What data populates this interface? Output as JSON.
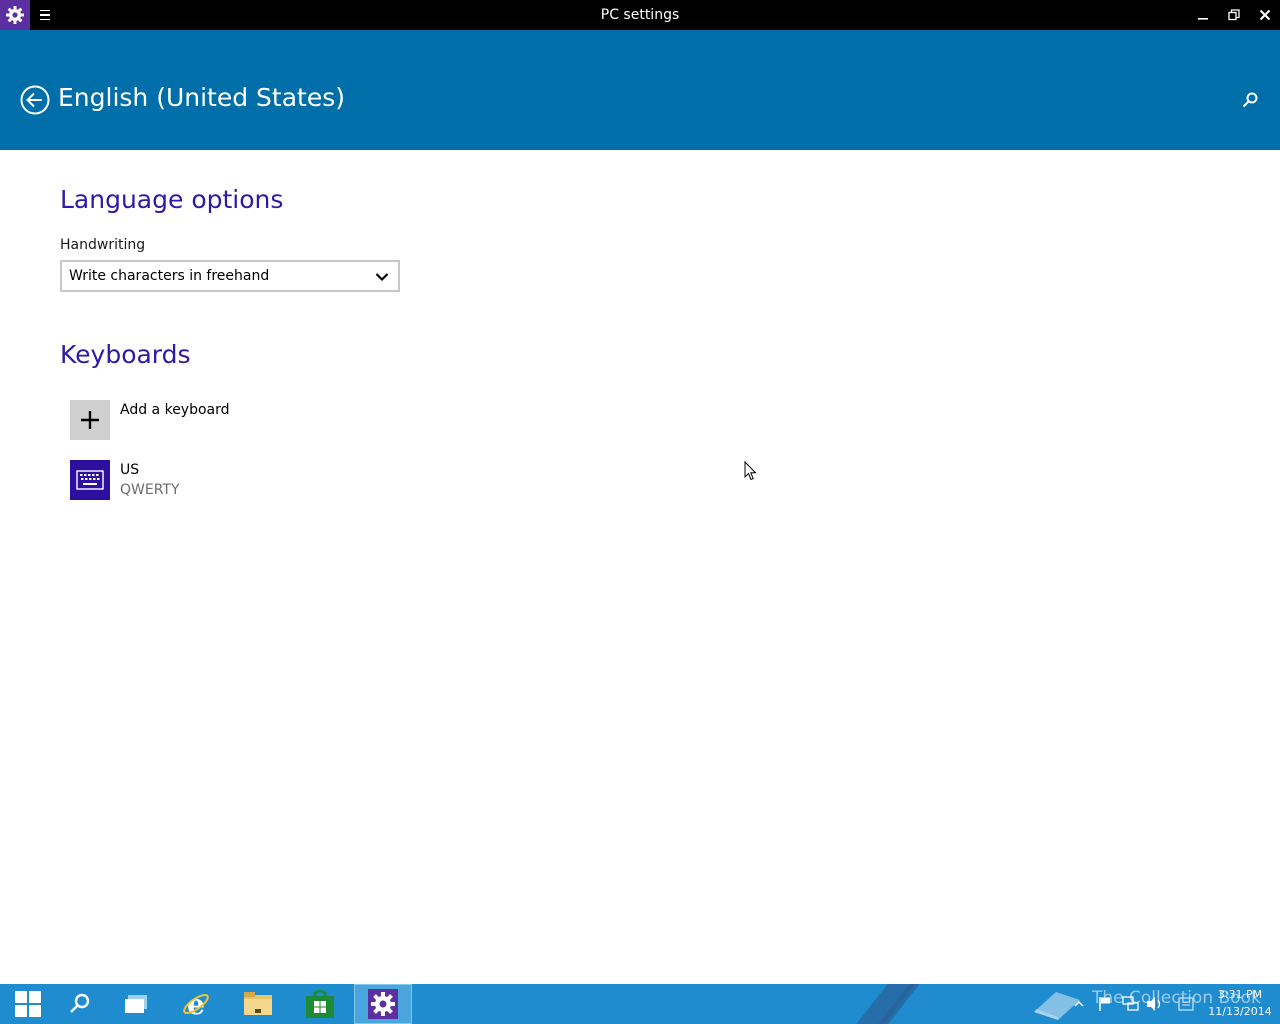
{
  "window": {
    "title": "PC settings"
  },
  "header": {
    "title": "English (United States)"
  },
  "language_options": {
    "heading": "Language options",
    "handwriting_label": "Handwriting",
    "handwriting_value": "Write characters in freehand"
  },
  "keyboards": {
    "heading": "Keyboards",
    "add_label": "Add a keyboard",
    "items": [
      {
        "name": "US",
        "layout": "QWERTY"
      }
    ]
  },
  "taskbar": {
    "time": "3:31 PM",
    "date": "11/13/2014",
    "watermark": "The Collection Book"
  },
  "colors": {
    "header_bg": "#006ea8",
    "section_heading": "#2d1aa8",
    "keyboard_tile": "#2d0fa0",
    "taskbar_bg": "#1f8cd0"
  },
  "icons": {
    "app": "gear-icon",
    "menu": "hamburger-icon",
    "back": "back-arrow-icon",
    "search": "search-icon",
    "dropdown": "chevron-down-icon",
    "add": "plus-icon",
    "keyboard": "keyboard-icon"
  }
}
